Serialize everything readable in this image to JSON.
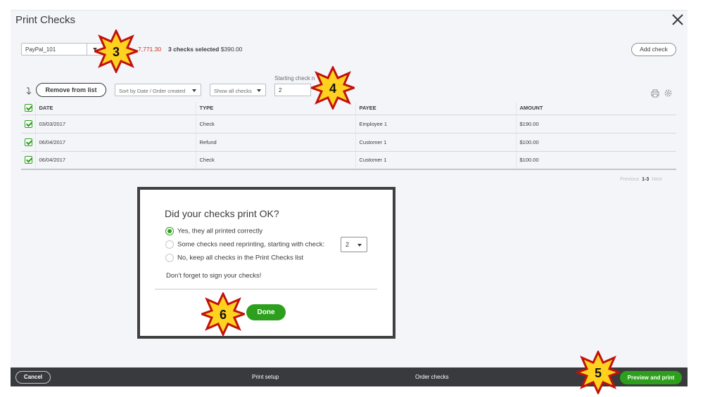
{
  "header": {
    "title": "Print Checks"
  },
  "toolbar": {
    "account": "PayPal_101",
    "balance": "7,771.30",
    "selected_count": "3 checks selected",
    "selected_total": "$390.00",
    "add_check": "Add check",
    "starting_check_label": "Starting check n",
    "starting_check_value": "2",
    "remove_from_list": "Remove from list",
    "sort_value": "Sort by Date / Order created",
    "filter_value": "Show all checks"
  },
  "table": {
    "columns": [
      "DATE",
      "TYPE",
      "PAYEE",
      "AMOUNT"
    ],
    "rows": [
      {
        "date": "03/03/2017",
        "type": "Check",
        "payee": "Employee 1",
        "amount": "$190.00"
      },
      {
        "date": "06/04/2017",
        "type": "Refund",
        "payee": "Customer 1",
        "amount": "$100.00"
      },
      {
        "date": "06/04/2017",
        "type": "Check",
        "payee": "Customer 1",
        "amount": "$100.00"
      }
    ],
    "pager": {
      "previous": "Previous",
      "range": "1-3",
      "next": "Next"
    }
  },
  "dialog": {
    "title": "Did your checks print OK?",
    "options": [
      "Yes, they all printed correctly",
      "Some checks need reprinting, starting with check:",
      "No, keep all checks in the Print Checks list"
    ],
    "selected_option": 0,
    "reprint_start": "2",
    "note": "Don't forget to sign your checks!",
    "done": "Done"
  },
  "footer": {
    "cancel": "Cancel",
    "print_setup": "Print setup",
    "order_checks": "Order checks",
    "preview_and_print": "Preview and print"
  },
  "callouts": [
    "3",
    "4",
    "5",
    "6"
  ],
  "colors": {
    "accent_green": "#2ca01c",
    "footer_bg": "#393a3d",
    "negative_red": "#d52b1e",
    "callout_fill": "#ffd21f",
    "callout_stroke": "#c0120c"
  }
}
